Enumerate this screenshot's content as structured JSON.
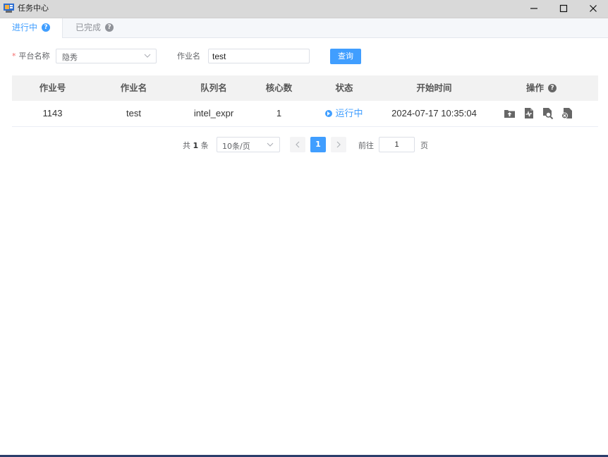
{
  "window": {
    "title": "任务中心",
    "minimize_label": "minimize",
    "maximize_label": "maximize",
    "close_label": "close"
  },
  "tabs": [
    {
      "label": "进行中",
      "active": true,
      "help": "?"
    },
    {
      "label": "已完成",
      "active": false,
      "help": "?"
    }
  ],
  "filters": {
    "required_mark": "*",
    "platform_label": "平台名称",
    "platform_value": "隐秀",
    "job_label": "作业名",
    "job_value": "test",
    "query_button": "查询"
  },
  "table": {
    "columns": [
      "作业号",
      "作业名",
      "队列名",
      "核心数",
      "状态",
      "开始时间",
      "操作"
    ],
    "ops_help": "?",
    "rows": [
      {
        "job_id": "1143",
        "job_name": "test",
        "queue": "intel_expr",
        "cores": "1",
        "status": "运行中",
        "start_time": "2024-07-17 10:35:04",
        "actions": [
          "upload-icon",
          "file-signal-icon",
          "file-search-icon",
          "file-cancel-icon"
        ]
      }
    ]
  },
  "pagination": {
    "total_prefix": "共",
    "total_count": "1",
    "total_suffix": "条",
    "page_size": "10条/页",
    "current_page": "1",
    "goto_label": "前往",
    "goto_value": "1",
    "goto_unit": "页"
  },
  "colors": {
    "accent": "#409eff",
    "required": "#f56c6c",
    "header_bg": "#f2f2f2"
  }
}
